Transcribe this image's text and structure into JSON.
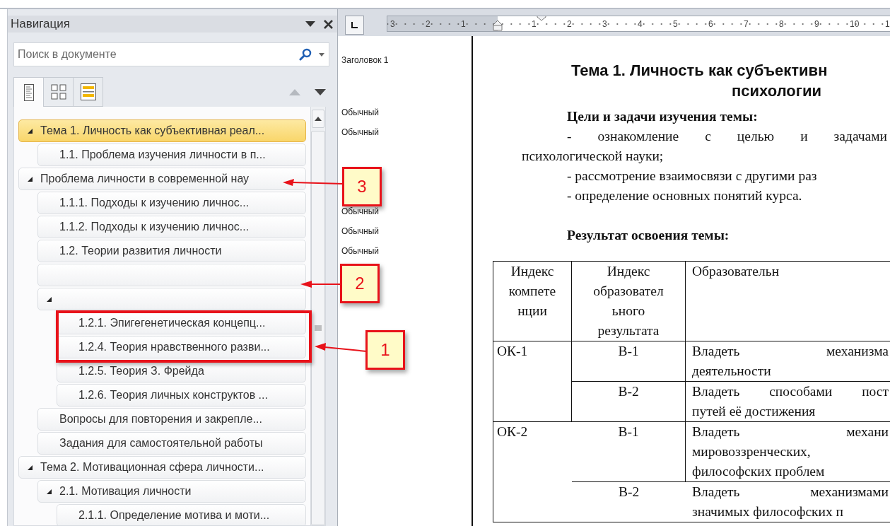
{
  "navigation": {
    "title": "Навигация",
    "search": {
      "placeholder": "Поиск в документе"
    },
    "view_tabs": [
      {
        "kind": "headings",
        "selected": true
      },
      {
        "kind": "pages",
        "selected": false
      },
      {
        "kind": "results",
        "selected": false
      }
    ],
    "tree": [
      {
        "label": "Тема 1. Личность как субъективная реал...",
        "selected": true,
        "expanded": true,
        "children": [
          {
            "label": "1.1. Проблема изучения личности в п...",
            "selected": false,
            "expanded": false
          }
        ]
      },
      {
        "label": "Проблема личности в современной нау",
        "selected": false,
        "expanded": true,
        "children": [
          {
            "label": "1.1.1. Подходы к изучению личнос...",
            "selected": false,
            "expanded": false
          },
          {
            "label": "1.1.2. Подходы к изучению личнос...",
            "selected": false,
            "expanded": false
          },
          {
            "label": "1.2. Теории развития личности",
            "selected": false,
            "expanded": false
          },
          {
            "selected": false,
            "expanded": false
          },
          {
            "selected": false,
            "expanded": true,
            "children": [
              {
                "label": "1.2.1. Эпигегенетическая концепц...",
                "selected": false,
                "expanded": false
              },
              {
                "label": "1.2.4. Теория нравственного разви...",
                "selected": false,
                "expanded": false
              },
              {
                "label": "1.2.5. Теория З. Фрейда",
                "selected": false,
                "expanded": false
              },
              {
                "label": "1.2.6. Теория личных конструктов ...",
                "selected": false,
                "expanded": false
              }
            ]
          },
          {
            "label": "Вопросы для повторения и закрепле...",
            "selected": false,
            "expanded": false
          },
          {
            "label": "Задания для самостоятельной работы",
            "selected": false,
            "expanded": false
          }
        ]
      },
      {
        "label": "Тема 2. Мотивационная сфера личности...",
        "selected": false,
        "expanded": true,
        "children": [
          {
            "label": "2.1. Мотивация личности",
            "selected": false,
            "expanded": true,
            "children": [
              {
                "label": "2.1.1. Определение мотива и моти...",
                "selected": false,
                "expanded": false
              }
            ]
          }
        ]
      }
    ]
  },
  "ruler": {
    "left_numbers": [
      "3",
      "2",
      "1"
    ],
    "right_numbers": [
      "1",
      "2",
      "3",
      "4",
      "5",
      "6",
      "7",
      "8",
      "9",
      "10",
      "1"
    ]
  },
  "style_labels": [
    "Заголовок 1",
    "Обычный",
    "Обычный",
    "Обычный",
    "Обычный",
    "Обычный"
  ],
  "document": {
    "heading_lines": [
      "Тема 1. Личность как субъективн",
      "психологии"
    ],
    "paragraphs": [
      {
        "kind": "bold",
        "text": "Цели и задачи изучения темы:"
      },
      {
        "kind": "justified",
        "text": "-  ознакомление  с  целью  и  задачами"
      },
      {
        "kind": "flush",
        "text": "психологической науки;"
      },
      {
        "kind": "indent",
        "text": "- рассмотрение взаимосвязи с другими раз"
      },
      {
        "kind": "indent",
        "text": "- определение основных понятий курса."
      },
      {
        "kind": "gap"
      },
      {
        "kind": "bold",
        "text": "Результат освоения темы:"
      }
    ],
    "table": {
      "columns": [
        "Индекс\nкомпете\nнции",
        "Индекс\nобразовател\nьного\nрезультата",
        "Образовательн"
      ],
      "rows": [
        {
          "index": "ОК-1",
          "result": "В-1",
          "lines": [
            "Владеть механизма",
            "деятельности"
          ]
        },
        {
          "result": "В-2",
          "lines": [
            "Владеть способами пост",
            "путей её достижения"
          ]
        },
        {
          "index": "ОК-2",
          "result": "В-1",
          "lines": [
            "Владеть механи",
            "мировоззренческих,",
            "философских проблем"
          ]
        },
        {
          "result": "В-2",
          "lines": [
            "Владеть механизмами",
            "значимых философских п"
          ]
        }
      ]
    }
  },
  "annotations": [
    {
      "label": "3"
    },
    {
      "label": "2"
    },
    {
      "label": "1"
    }
  ]
}
